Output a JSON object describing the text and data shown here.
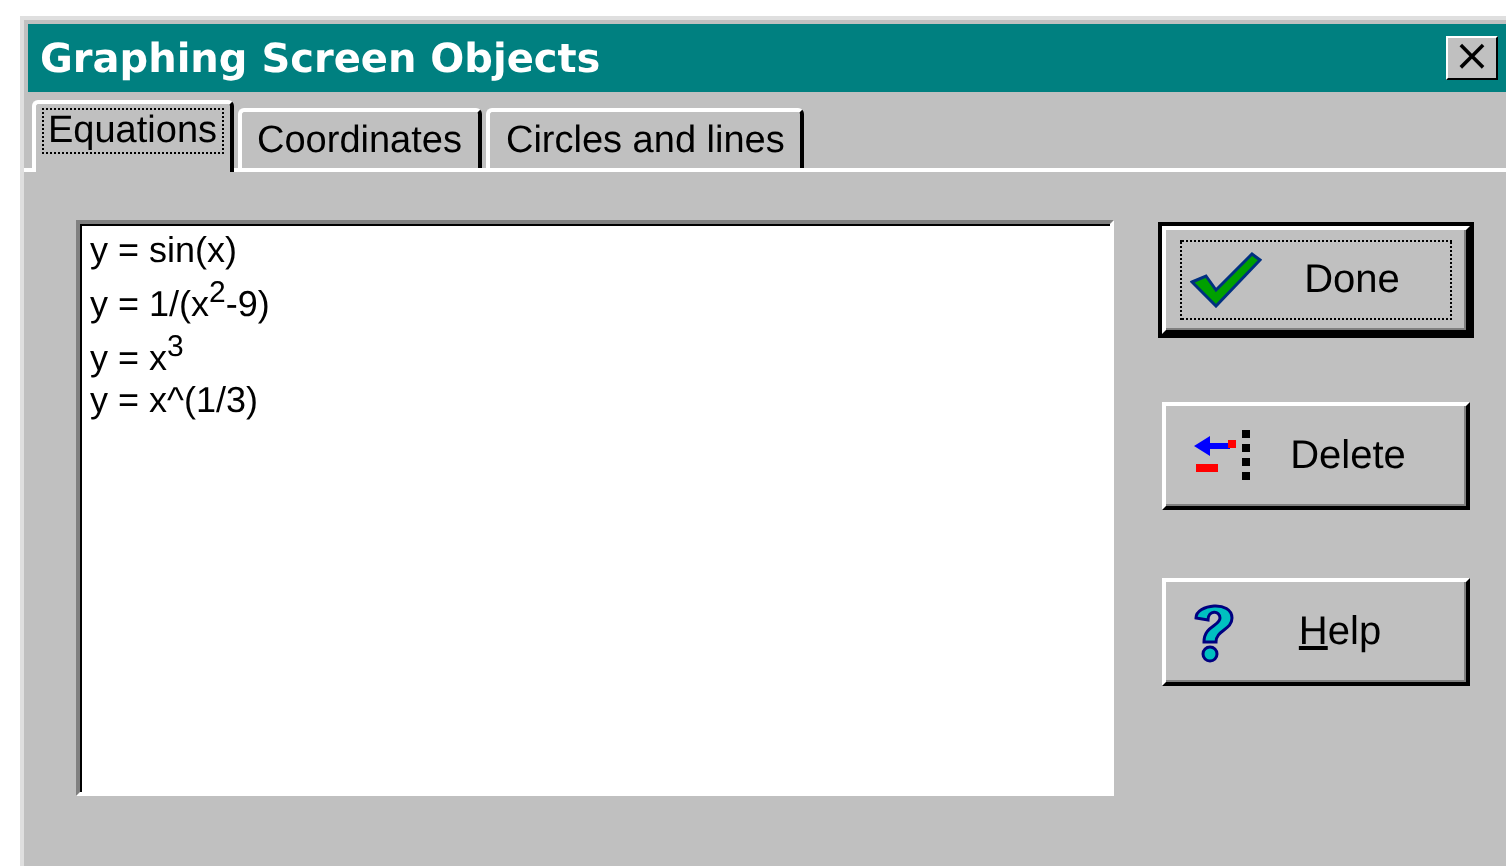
{
  "window": {
    "title": "Graphing Screen Objects",
    "close": "×"
  },
  "tabs": [
    {
      "label": "Equations",
      "selected": true
    },
    {
      "label": "Coordinates",
      "selected": false
    },
    {
      "label": "Circles and lines",
      "selected": false
    }
  ],
  "list": {
    "items": [
      "y = sin(x)",
      "y = 1/(x$^{2}$-9)",
      "y = x$^{3}$",
      "y = x^(1/3)"
    ]
  },
  "buttons": [
    {
      "kind": "done",
      "label": "Done",
      "default": true,
      "mnemonic": false
    },
    {
      "kind": "delete",
      "label": "Delete",
      "default": false,
      "mnemonic": false
    },
    {
      "kind": "help",
      "label": "Help",
      "default": false,
      "mnemonic": true
    }
  ]
}
